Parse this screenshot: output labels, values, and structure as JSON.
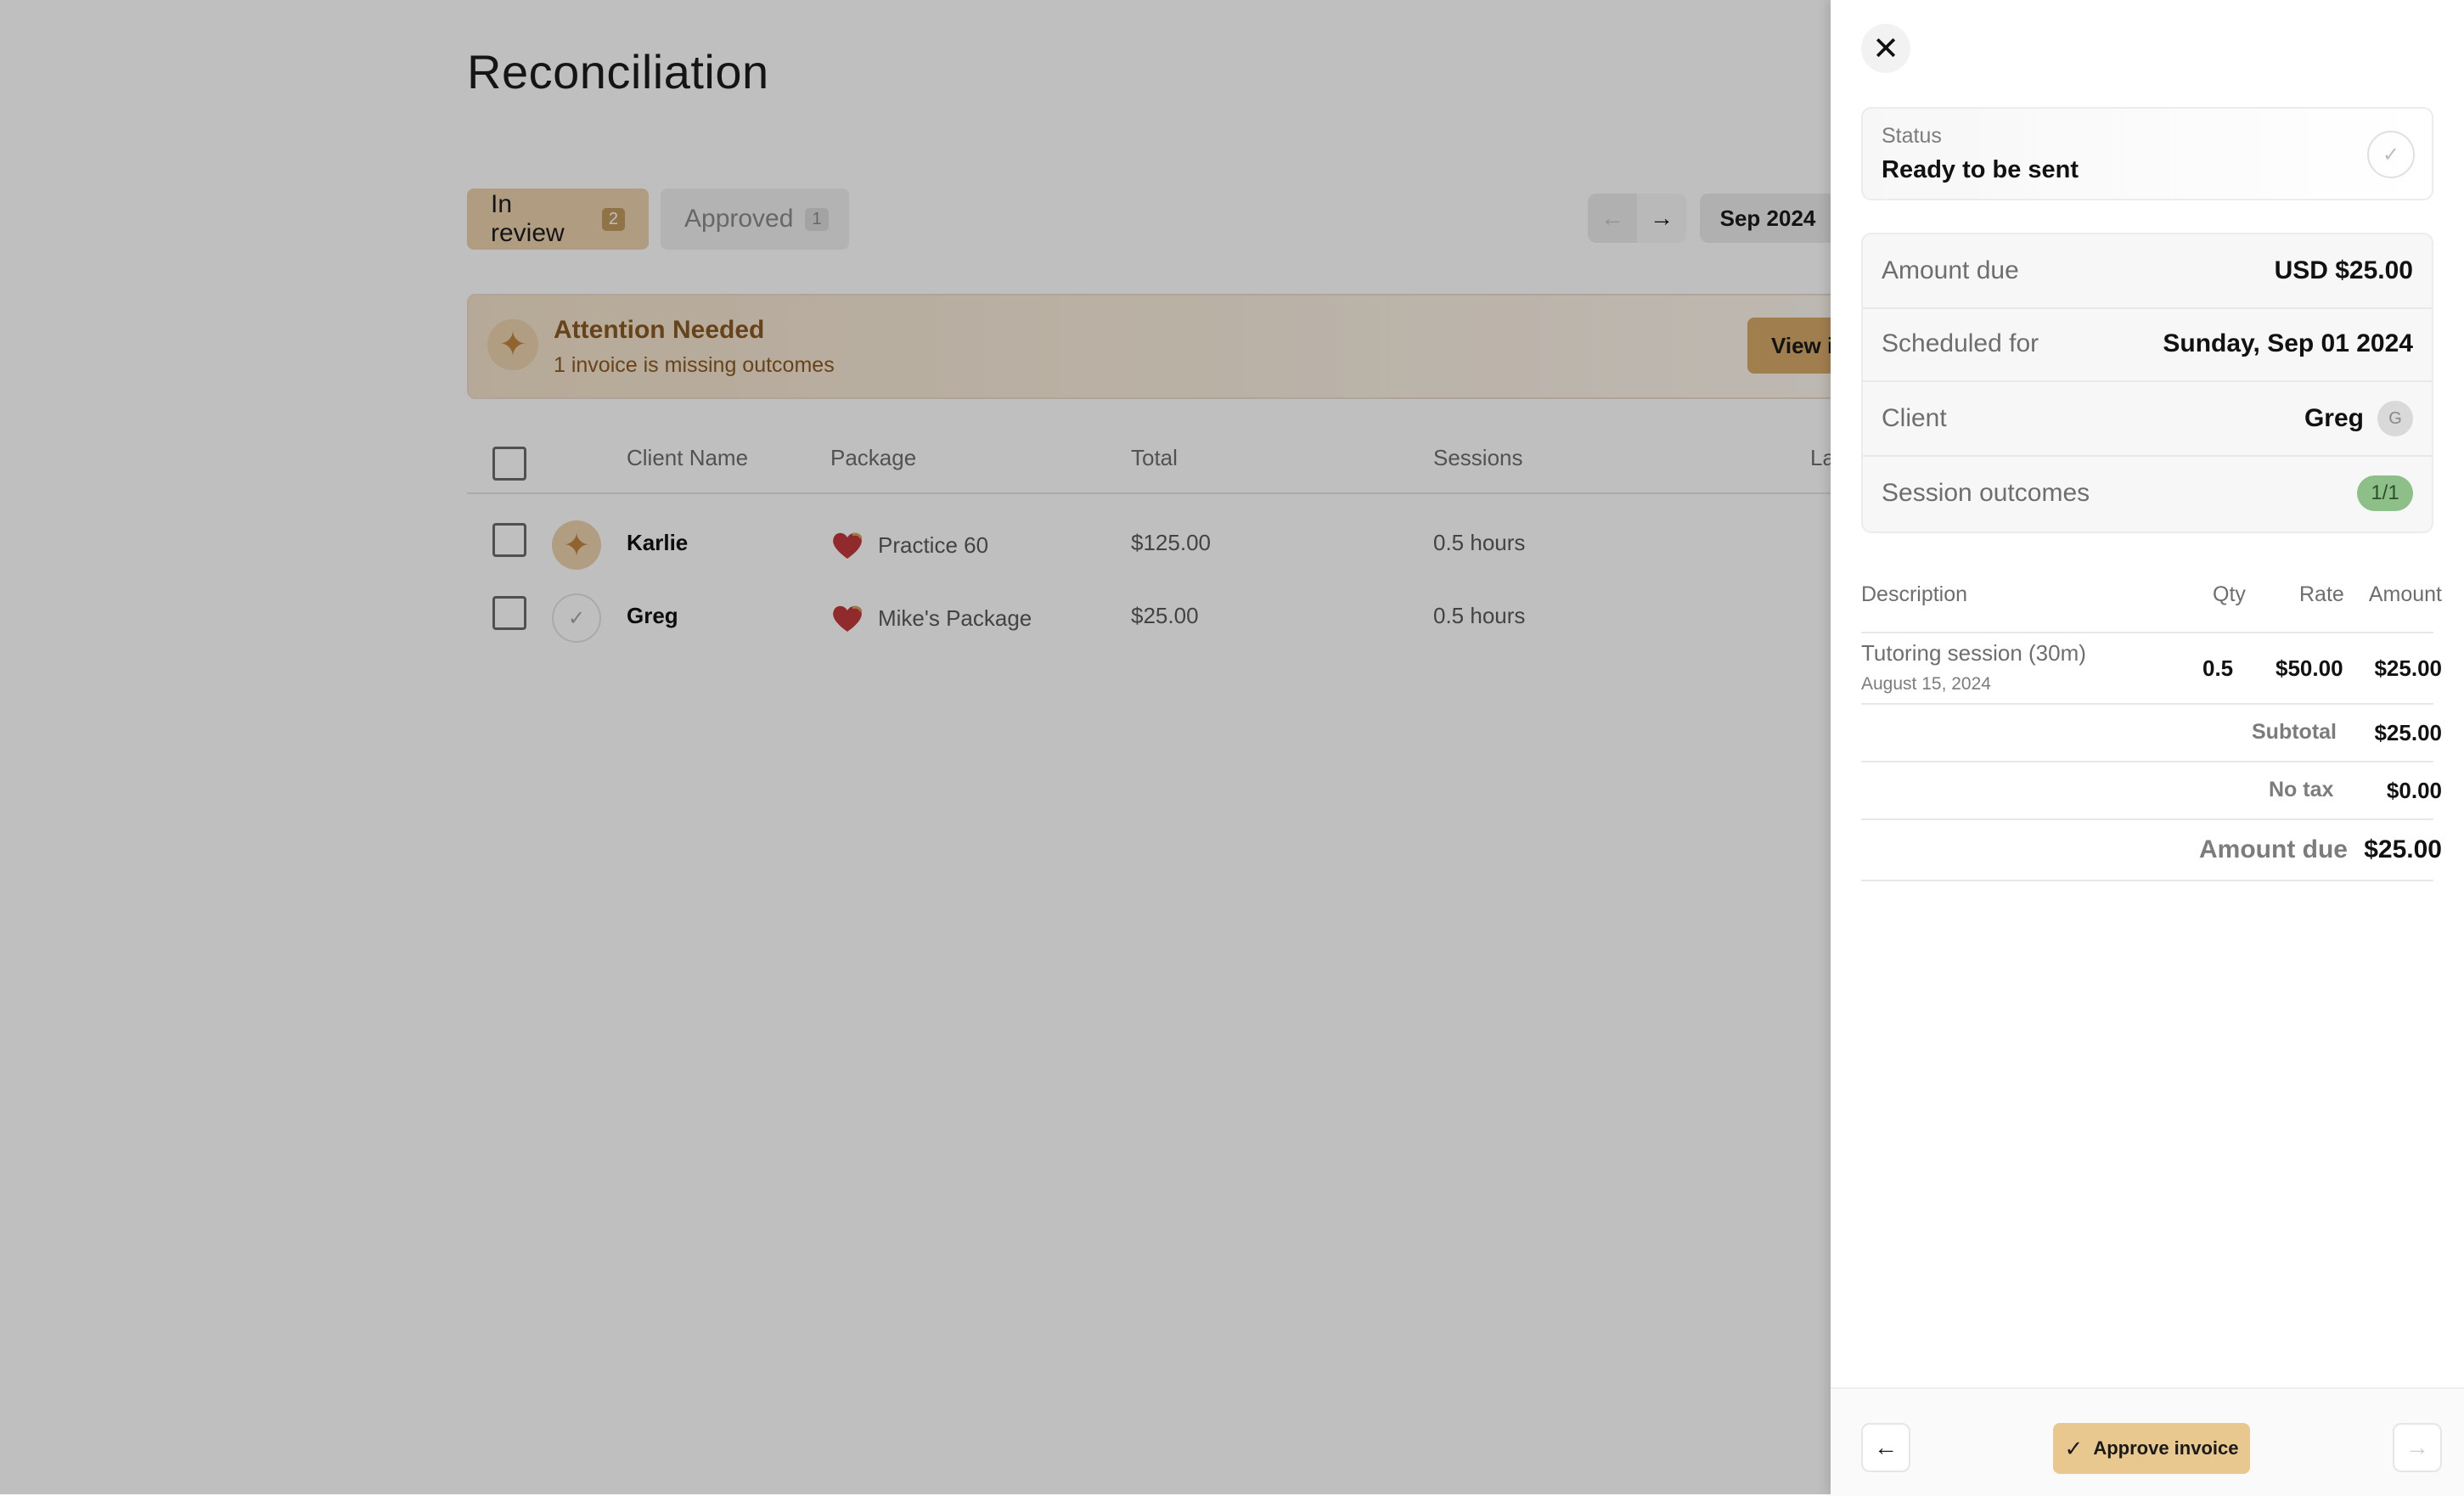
{
  "page": {
    "title": "Reconciliation"
  },
  "tabs": [
    {
      "label": "In review",
      "count": "2"
    },
    {
      "label": "Approved",
      "count": "1"
    }
  ],
  "period": {
    "prev_icon": "arrow-left-icon",
    "next_icon": "arrow-right-icon",
    "month": "Sep 2024"
  },
  "banner": {
    "title": "Attention Needed",
    "subtitle": "1 invoice is missing outcomes",
    "button": "View invoice",
    "icon": "sparkle-icon"
  },
  "table": {
    "headers": [
      "Client Name",
      "Package",
      "Total",
      "Sessions",
      "La"
    ],
    "rows": [
      {
        "status": "sparkle",
        "name": "Karlie",
        "package": "Practice 60",
        "total": "$125.00",
        "sessions": "0.5 hours"
      },
      {
        "status": "check",
        "name": "Greg",
        "package": "Mike's Package",
        "total": "$25.00",
        "sessions": "0.5 hours"
      }
    ]
  },
  "panel": {
    "status_label": "Status",
    "status_value": "Ready to be sent",
    "info": {
      "amount_due_label": "Amount due",
      "amount_due_value": "USD $25.00",
      "scheduled_label": "Scheduled for",
      "scheduled_value": "Sunday, Sep 01 2024",
      "client_label": "Client",
      "client_value": "Greg",
      "client_initial": "G",
      "outcomes_label": "Session outcomes",
      "outcomes_value": "1/1"
    },
    "line_items": {
      "headers": {
        "description": "Description",
        "qty": "Qty",
        "rate": "Rate",
        "amount": "Amount"
      },
      "items": [
        {
          "description": "Tutoring session (30m)",
          "date": "August 15, 2024",
          "qty": "0.5",
          "rate": "$50.00",
          "amount": "$25.00"
        }
      ],
      "subtotal_label": "Subtotal",
      "subtotal_value": "$25.00",
      "tax_label": "No tax",
      "tax_value": "$0.00",
      "total_label": "Amount due",
      "total_value": "$25.00"
    },
    "footer": {
      "approve_label": "Approve invoice"
    }
  },
  "colors": {
    "accent": "#d7a868",
    "accent_light": "#ead1ad",
    "success": "#8dbf88",
    "overlay": "#bfbfbf"
  }
}
